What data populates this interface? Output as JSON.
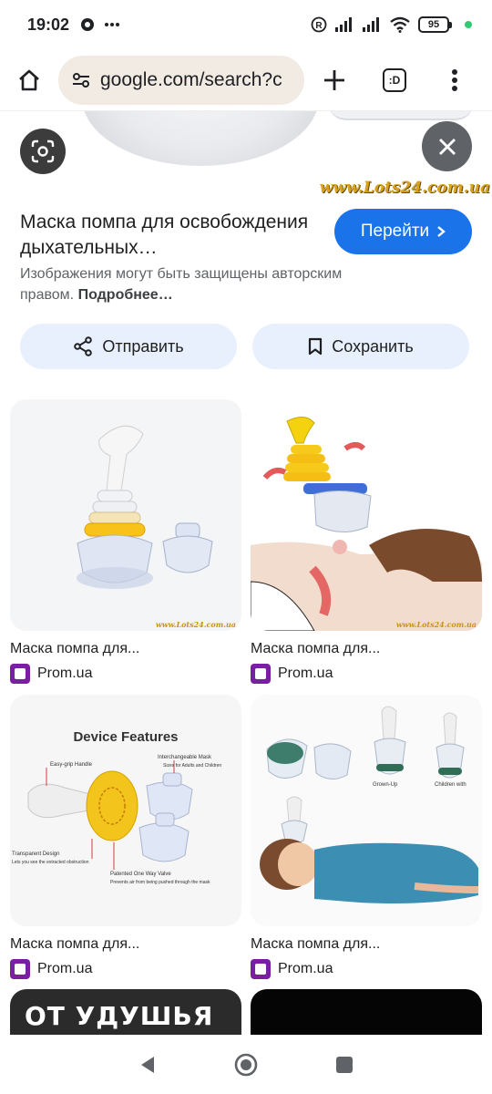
{
  "status_bar": {
    "time": "19:02",
    "battery": "95"
  },
  "browser": {
    "url": "google.com/search?c",
    "tab_label": ":D"
  },
  "preview": {
    "watermark": "www.Lots24.com.ua"
  },
  "result": {
    "title": "Маска помпа для освобождения дыхательных…",
    "visit_label": "Перейти",
    "copyright_text": "Изображения могут быть защищены авторским правом.",
    "more_label": "Подробнее…",
    "share_label": "Отправить",
    "save_label": "Сохранить"
  },
  "cards": [
    {
      "title": "Маска помпа для...",
      "source": "Prom.ua",
      "watermark": "www.Lots24.com.ua"
    },
    {
      "title": "Маска помпа для...",
      "source": "Prom.ua",
      "watermark": "www.Lots24.com.ua"
    },
    {
      "title": "Маска помпа для...",
      "source": "Prom.ua",
      "heading": "Device Features",
      "labels": [
        "Easy-grip Handle",
        "Interchangeable Mask",
        "Sizes for Adults and Children",
        "Transparent Design",
        "Lets you see the extracted obstruction",
        "Patented One Way Valve",
        "Prevents air from being pushed through the mask"
      ]
    },
    {
      "title": "Маска помпа для...",
      "source": "Prom.ua",
      "labels": [
        "Grown-Up",
        "Children with"
      ]
    }
  ],
  "bottom_cards": [
    {
      "text": "ОТ УДУШЬЯ"
    },
    {
      "text": ""
    }
  ],
  "colors": {
    "accent": "#1a73e8",
    "tonal": "#e8f0fe",
    "source_icon": "#7b1fa2"
  }
}
